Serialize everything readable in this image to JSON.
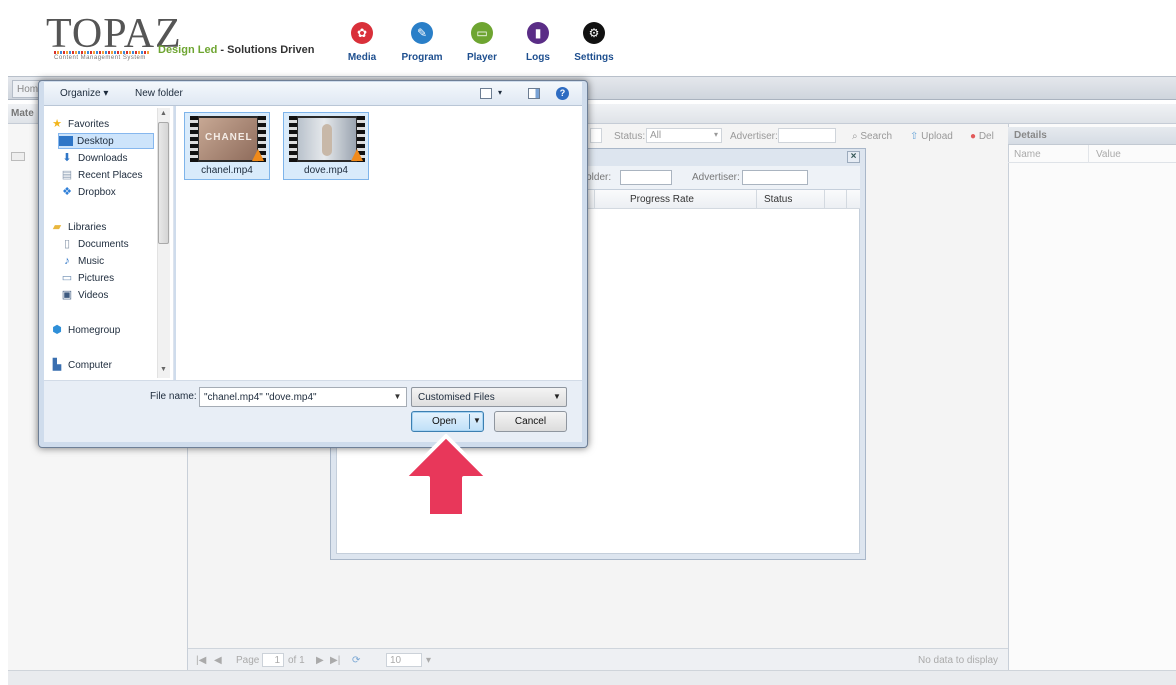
{
  "header": {
    "logo_text": "TOPAZ",
    "logo_subtext": "Content Management System",
    "tagline_highlight": "Design Led",
    "tagline_rest": " - Solutions Driven",
    "nav": [
      {
        "label": "Media",
        "icon": "media-icon",
        "color": "#d9303a"
      },
      {
        "label": "Program",
        "icon": "program-icon",
        "color": "#2a7fc8"
      },
      {
        "label": "Player",
        "icon": "player-icon",
        "color": "#6ea531"
      },
      {
        "label": "Logs",
        "icon": "logs-icon",
        "color": "#5a2d86"
      },
      {
        "label": "Settings",
        "icon": "gear-icon",
        "color": "#111111"
      }
    ]
  },
  "app": {
    "home_tab": "Hom",
    "material_title": "Mate",
    "filter": {
      "status_label": "Status:",
      "status_value": "All",
      "advertiser_label": "Advertiser:",
      "search": "Search",
      "upload": "Upload",
      "delete": "Del"
    },
    "details": {
      "title": "Details",
      "col_name": "Name",
      "col_value": "Value"
    },
    "pager": {
      "page_label": "Page",
      "page_value": "1",
      "of_label": "of 1",
      "page_size": "10",
      "empty": "No data to display"
    }
  },
  "upload_window": {
    "folder_label": "Folder:",
    "advertiser_label": "Advertiser:",
    "columns": [
      "Progress Rate",
      "Status"
    ]
  },
  "dialog": {
    "organize": "Organize ▾",
    "new_folder": "New folder",
    "nav": {
      "favorites": "Favorites",
      "desktop": "Desktop",
      "downloads": "Downloads",
      "recent_places": "Recent Places",
      "dropbox": "Dropbox",
      "libraries": "Libraries",
      "documents": "Documents",
      "music": "Music",
      "pictures": "Pictures",
      "videos": "Videos",
      "homegroup": "Homegroup",
      "computer": "Computer"
    },
    "files": [
      {
        "name": "chanel.mp4",
        "thumb_text": "CHANEL"
      },
      {
        "name": "dove.mp4",
        "thumb_text": ""
      }
    ],
    "file_name_label": "File name:",
    "file_name_value": "\"chanel.mp4\" \"dove.mp4\"",
    "file_type": "Customised Files",
    "open": "Open",
    "cancel": "Cancel"
  }
}
